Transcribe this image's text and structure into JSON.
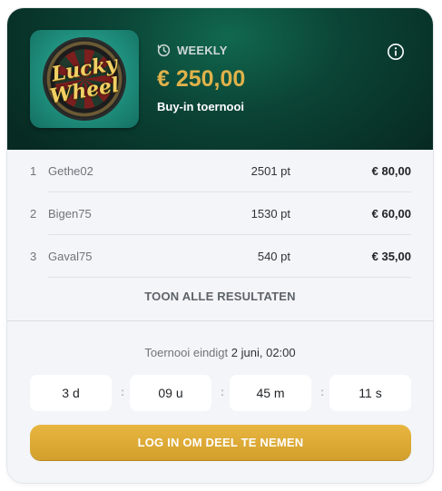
{
  "tournament": {
    "game_logo_text": [
      "Lucky",
      "Wheel"
    ],
    "frequency": "WEEKLY",
    "prize_pool": "€ 250,00",
    "type": "Buy-in toernooi"
  },
  "leaderboard": [
    {
      "rank": "1",
      "name": "Gethe02",
      "points": "2501 pt",
      "prize": "€ 80,00"
    },
    {
      "rank": "2",
      "name": "Bigen75",
      "points": "1530 pt",
      "prize": "€ 60,00"
    },
    {
      "rank": "3",
      "name": "Gaval75",
      "points": "540 pt",
      "prize": "€ 35,00"
    }
  ],
  "show_all_label": "TOON ALLE RESULTATEN",
  "ends": {
    "label": "Toernooi eindigt",
    "date": "2 juni, 02:00"
  },
  "countdown": {
    "days": "3 d",
    "hours": "09 u",
    "minutes": "45 m",
    "seconds": "11 s",
    "separator": ":"
  },
  "cta_label": "LOG IN OM DEEL TE NEMEN",
  "icons": {
    "frequency": "clock-icon",
    "info": "info-icon"
  },
  "colors": {
    "header_bg": "#0b4436",
    "prize_gold": "#e0b24a",
    "cta_gold": "#d9a733"
  }
}
